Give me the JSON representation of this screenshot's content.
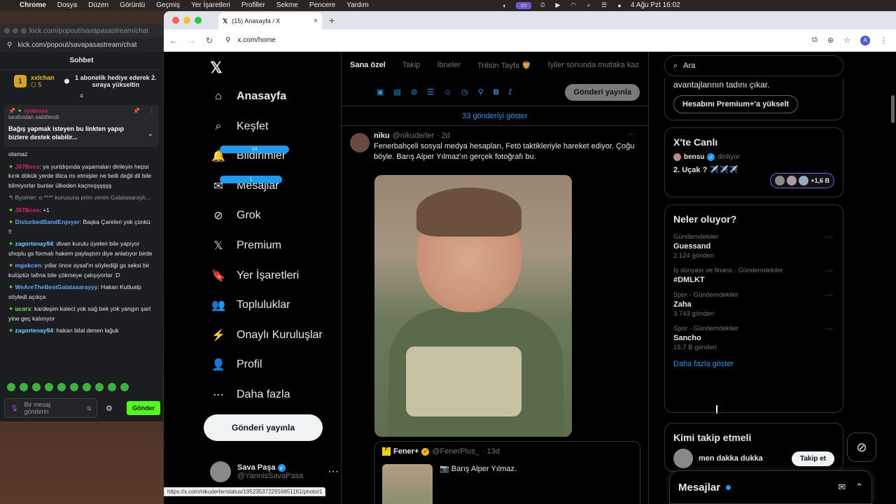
{
  "menubar": {
    "app": "Chrome",
    "items": [
      "Dosya",
      "Düzen",
      "Görüntü",
      "Geçmiş",
      "Yer İşaretleri",
      "Profiller",
      "Sekme",
      "Pencere",
      "Yardım"
    ],
    "clock": "4 Ağu Pzt  16:02"
  },
  "kick": {
    "window_url_top": "kick.com/popout/savapasastream/chat",
    "url": "kick.com/popout/savapasastream/chat",
    "header": "Sohbet",
    "gift": {
      "user": "xxlchan",
      "count": "5",
      "text": "1 abonelik hediye ederek 2. sıraya yükseltin"
    },
    "pinned": {
      "user": "ryutensa",
      "by": "tarafından sabitlendi",
      "message": "Bağış yapmak isteyen bu linkten yapıp bizlere destek olabilir..."
    },
    "messages": [
      {
        "user": "",
        "text": "olamaz",
        "color": "#e5e5e5"
      },
      {
        "user": "J67Boss",
        "text": ": ya yurtdışında yaşamaları dinleyin hepsi kırık dökük yerde iltica mı etmişler ne belli değil dil bile bilmiyorlar bunlar ülkeden kaçmışşşşşş",
        "color": "#e0245e"
      },
      {
        "user": "",
        "text": "↰ Byomer: o **** kurusuna prim veren Galatasaraylı...",
        "color": "#9a9a9a"
      },
      {
        "user": "J67Boss",
        "text": ": +1",
        "color": "#e0245e"
      },
      {
        "user": "DisturbedBandEnjoyer",
        "text": ": Başka Çareleri yok çünkü !!",
        "color": "#5fa8ff"
      },
      {
        "user": "zagortenay94",
        "text": ": divan kurulu üyeleri bile yapıyor shoplu gs formalı hakem paylaştım diye anlatıyor birde",
        "color": "#6cd8ff"
      },
      {
        "user": "mgokcen",
        "text": ": yıllar önce aysal'ın söylediği gs seksi bir kulüptür lafına bile çökmeye çalışıyorlar :D",
        "color": "#6aa8ff"
      },
      {
        "user": "WeAreTheBestGalatasarayyy",
        "text": ": Hakan Kutlualp söyledi açıkça",
        "color": "#5fa8ff"
      },
      {
        "user": "ucarx",
        "text": ": kardeşim kaleci yok sağ bek yok yangın şart yine geç kalınıyor",
        "color": "#7be36b"
      },
      {
        "user": "zagortenay94",
        "text": ": hakan bilal denen lağuk",
        "color": "#6cd8ff"
      }
    ],
    "input_placeholder": "Bir mesaj gönderin",
    "send": "Gönder"
  },
  "chrome": {
    "tab_title": "(15) Anasayfa / X",
    "address": "x.com/home",
    "profile_initial": "A",
    "status_url": "https://x.com/nikuderler/status/1952353722916651161/photo/1"
  },
  "x": {
    "logo": "𝕏",
    "nav": [
      {
        "label": "Anasayfa",
        "icon": "home-icon",
        "glyph": "⌂",
        "badge": ""
      },
      {
        "label": "Keşfet",
        "icon": "search-icon",
        "glyph": "⌕",
        "badge": ""
      },
      {
        "label": "Bildirimler",
        "icon": "bell-icon",
        "glyph": "🔔",
        "badge": "14"
      },
      {
        "label": "Mesajlar",
        "icon": "mail-icon",
        "glyph": "✉",
        "badge": "1"
      },
      {
        "label": "Grok",
        "icon": "grok-icon",
        "glyph": "⊘",
        "badge": ""
      },
      {
        "label": "Premium",
        "icon": "x-premium-icon",
        "glyph": "𝕏",
        "badge": ""
      },
      {
        "label": "Yer İşaretleri",
        "icon": "bookmark-icon",
        "glyph": "🔖",
        "badge": ""
      },
      {
        "label": "Topluluklar",
        "icon": "communities-icon",
        "glyph": "👥",
        "badge": ""
      },
      {
        "label": "Onaylı Kuruluşlar",
        "icon": "lightning-icon",
        "glyph": "⚡",
        "badge": ""
      },
      {
        "label": "Profil",
        "icon": "profile-icon",
        "glyph": "👤",
        "badge": ""
      },
      {
        "label": "Daha fazla",
        "icon": "more-circle-icon",
        "glyph": "⋯",
        "badge": ""
      }
    ],
    "post_button": "Gönderi yayınla",
    "account": {
      "name": "Sava Paşa",
      "handle": "@YannisSavaPasa"
    },
    "tabs": [
      "Sana özel",
      "Takip",
      "İbneler",
      "Tribün Tayfa 🦁",
      "İyiler sonunda mutlaka kaz"
    ],
    "compose_post": "Gönderi yayınla",
    "show_posts": "33 gönderiyi göster",
    "tweet": {
      "name": "niku",
      "handle": "@nikuderler",
      "time": "· 2d",
      "text": "Fenerbahçeli sosyal medya hesapları, Fetö taktikleriyle hareket ediyor. Çoğu böyle. Barış Alper Yılmaz'ın gerçek fotoğrafı bu.",
      "quote": {
        "name": "Fener+",
        "handle": "@FenerPlus_",
        "time": "· 13d",
        "text": "📷 Barış Alper Yılmaz."
      }
    },
    "search_placeholder": "Ara",
    "premium": {
      "text": "avantajlarının tadını çıkar.",
      "button": "Hesabını Premium+'a yükselt"
    },
    "live": {
      "title": "X'te Canlı",
      "user": "bensu",
      "handle": "dinliyor",
      "topic": "2. Uçak ? ✈️✈️✈️",
      "count": "+1,6 B"
    },
    "trends_title": "Neler oluyor?",
    "trends": [
      {
        "cat": "Gündemdekiler",
        "name": "Guessand",
        "count": "2.124 gönderi"
      },
      {
        "cat": "İş dünyası ve finans · Gündemdekiler",
        "name": "#DMLKT",
        "count": ""
      },
      {
        "cat": "Spor · Gündemdekiler",
        "name": "Zaha",
        "count": "3.743 gönderi"
      },
      {
        "cat": "Spor · Gündemdekiler",
        "name": "Sancho",
        "count": "15,7 B gönderi"
      }
    ],
    "see_more": "Daha fazla göster",
    "who_title": "Kimi takip etmeli",
    "who": {
      "name": "men dakka dukka",
      "follow": "Takip et"
    },
    "dm_title": "Mesajlar"
  }
}
